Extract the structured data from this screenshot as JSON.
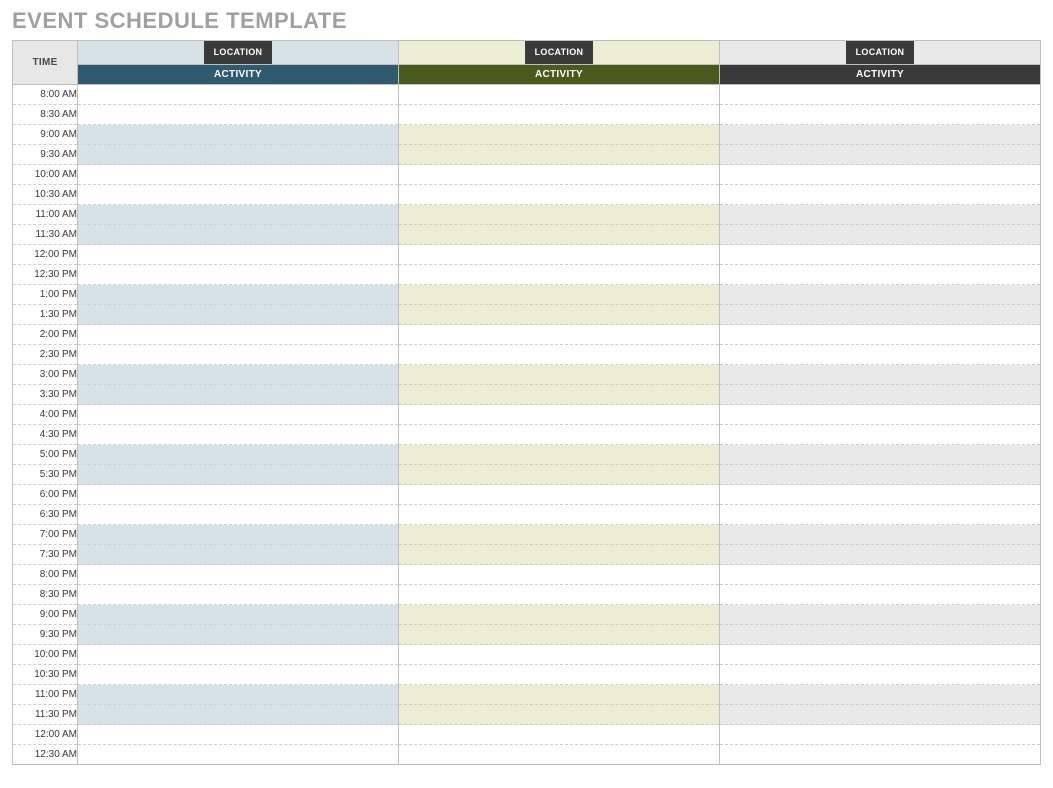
{
  "title": "EVENT SCHEDULE TEMPLATE",
  "headers": {
    "time": "TIME",
    "location": "LOCATION",
    "activity": "ACTIVITY"
  },
  "columns": [
    {
      "id": "c1"
    },
    {
      "id": "c2"
    },
    {
      "id": "c3"
    }
  ],
  "times": [
    "8:00 AM",
    "8:30 AM",
    "9:00 AM",
    "9:30 AM",
    "10:00 AM",
    "10:30 AM",
    "11:00 AM",
    "11:30 AM",
    "12:00 PM",
    "12:30 PM",
    "1:00 PM",
    "1:30 PM",
    "2:00 PM",
    "2:30 PM",
    "3:00 PM",
    "3:30 PM",
    "4:00 PM",
    "4:30 PM",
    "5:00 PM",
    "5:30 PM",
    "6:00 PM",
    "6:30 PM",
    "7:00 PM",
    "7:30 PM",
    "8:00 PM",
    "8:30 PM",
    "9:00 PM",
    "9:30 PM",
    "10:00 PM",
    "10:30 PM",
    "11:00 PM",
    "11:30 PM",
    "12:00 AM",
    "12:30 AM"
  ]
}
